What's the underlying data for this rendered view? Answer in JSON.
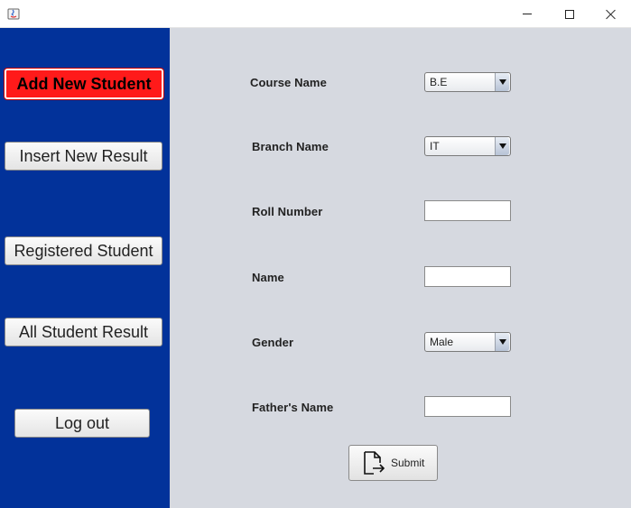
{
  "window": {
    "controls": {
      "minimize_icon": "minimize-icon",
      "maximize_icon": "maximize-icon",
      "close_icon": "close-icon"
    }
  },
  "sidebar": {
    "background": "#02329a",
    "buttons": [
      {
        "label": "Add New Student",
        "active": true
      },
      {
        "label": "Insert New Result"
      },
      {
        "label": "Registered Student"
      },
      {
        "label": "All Student Result"
      },
      {
        "label": "Log out"
      }
    ],
    "active_color": "#ff1a1a"
  },
  "form": {
    "fields": [
      {
        "label": "Course Name",
        "type": "select",
        "value": "B.E"
      },
      {
        "label": "Branch Name",
        "type": "select",
        "value": "IT"
      },
      {
        "label": "Roll Number",
        "type": "text",
        "value": ""
      },
      {
        "label": "Name",
        "type": "text",
        "value": ""
      },
      {
        "label": "Gender",
        "type": "select",
        "value": "Male"
      },
      {
        "label": "Father's Name",
        "type": "text",
        "value": ""
      }
    ],
    "submit": {
      "label": "Submit",
      "icon": "file-export-icon"
    }
  }
}
